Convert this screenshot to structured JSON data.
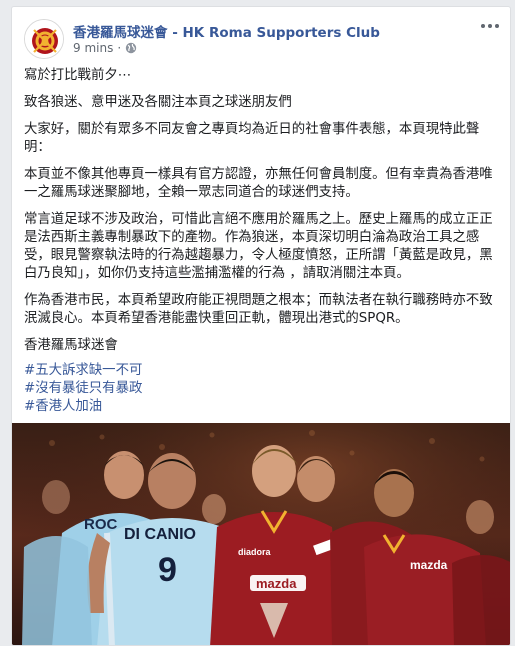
{
  "post": {
    "page_name": "香港羅馬球迷會 - HK Roma Supporters Club",
    "timestamp": "9 mins",
    "separator": "·",
    "paragraphs": [
      "寫於打比戰前夕⋯",
      "致各狼迷、意甲迷及各關注本頁之球迷朋友們",
      "大家好，關於有眾多不同友會之專頁均為近日的社會事件表態，本頁現特此聲明：",
      "本頁並不像其他專頁一樣具有官方認證，亦無任何會員制度。但有幸貴為香港唯一之羅馬球迷聚腳地，全賴一眾志同道合的球迷們支持。",
      "常言道足球不涉及政治，可惜此言絕不應用於羅馬之上。歷史上羅馬的成立正正是法西斯主義專制暴政下的產物。作為狼迷，本頁深切明白淪為政治工具之感受，眼見警察執法時的行為越趨暴力，令人極度憤怒，正所謂「黃藍是政見，黑白乃良知」，如你仍支持這些濫捕濫權的行為 ，請取消關注本頁。",
      "作為香港市民，本頁希望政府能正視問題之根本；而執法者在執行職務時亦不致泯滅良心。本頁希望香港能盡快重回正軌，體現出港式的SPQR。",
      "香港羅馬球迷會"
    ],
    "hashtags": [
      "#五大訴求缺一不可",
      "#沒有暴徒只有暴政",
      "#香港人加油"
    ]
  },
  "photo": {
    "jersey_name": "DI CANIO",
    "jersey_number": "9",
    "partial_name": "ROC",
    "sponsor": "mazda",
    "brand": "diadora"
  },
  "colors": {
    "link": "#385898",
    "roma_red": "#8f1a1e",
    "lazio_blue": "#a8d4ea",
    "text": "#1c1e21",
    "meta": "#606770"
  },
  "icons": [
    "more-options-icon",
    "globe-icon",
    "club-logo-icon"
  ]
}
